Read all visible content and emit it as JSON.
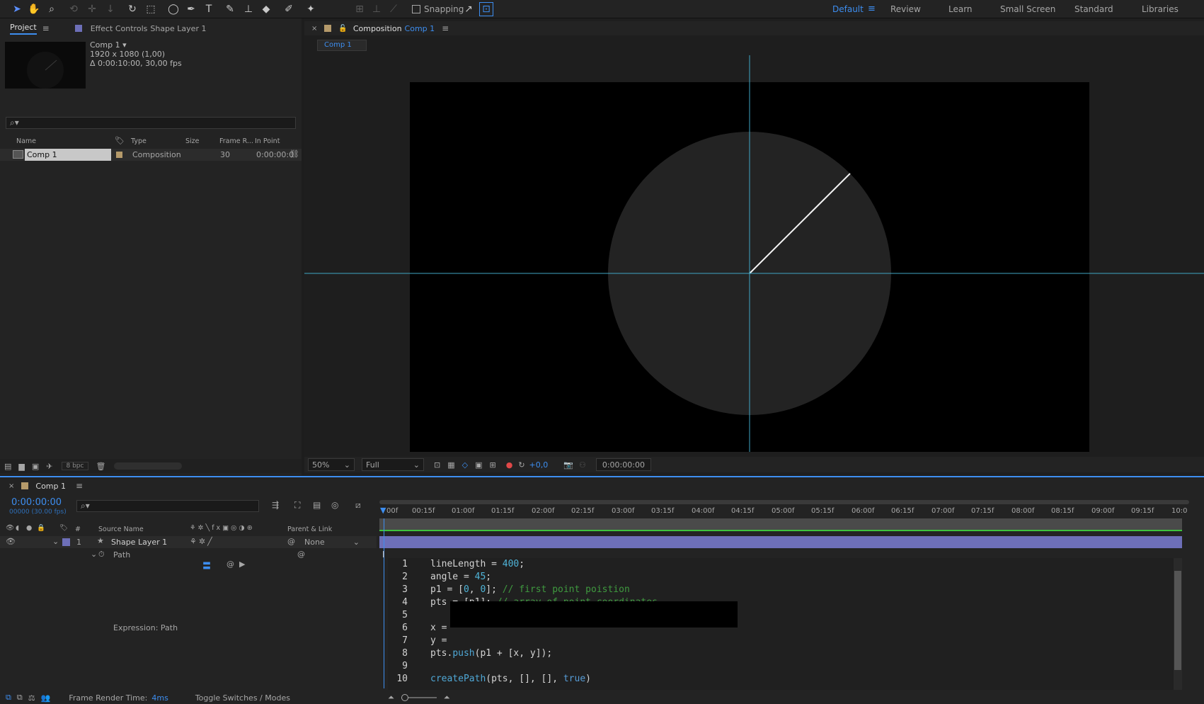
{
  "toolbar": {
    "snapping_label": "Snapping",
    "workspaces": [
      "Default",
      "Review",
      "Learn",
      "Small Screen",
      "Standard",
      "Libraries"
    ],
    "active_workspace": "Default"
  },
  "project_panel": {
    "tab_project": "Project",
    "tab_effect_controls": "Effect Controls",
    "effect_controls_target": "Shape Layer 1",
    "comp_name": "Comp 1 ▾",
    "comp_size": "1920 x 1080 (1,00)",
    "comp_duration": "Δ 0:00:10:00, 30,00 fps",
    "columns": [
      "Name",
      "Type",
      "Size",
      "Frame R...",
      "In Point"
    ],
    "items": [
      {
        "name": "Comp 1",
        "type": "Composition",
        "size": "",
        "frame_rate": "30",
        "in_point": "0:00:00:0"
      }
    ],
    "bpc": "8 bpc"
  },
  "viewer": {
    "tab_label": "Composition",
    "tab_comp": "Comp 1",
    "sub_tab": "Comp 1",
    "zoom": "50%",
    "resolution": "Full",
    "exposure": "+0,0",
    "timecode": "0:00:00:00"
  },
  "timeline": {
    "tab_label": "Comp 1",
    "current_time": "0:00:00:00",
    "frame_info": "00000 (30.00 fps)",
    "ruler_labels": [
      "00f",
      "00:15f",
      "01:00f",
      "01:15f",
      "02:00f",
      "02:15f",
      "03:00f",
      "03:15f",
      "04:00f",
      "04:15f",
      "05:00f",
      "05:15f",
      "06:00f",
      "06:15f",
      "07:00f",
      "07:15f",
      "08:00f",
      "08:15f",
      "09:00f",
      "09:15f",
      "10:0"
    ],
    "columns": {
      "hash": "#",
      "source_name": "Source Name",
      "parent_link": "Parent & Link"
    },
    "layers": [
      {
        "number": "1",
        "name": "Shape Layer 1",
        "parent": "None"
      }
    ],
    "property": "Path",
    "expression_label": "Expression: Path",
    "footer": {
      "render_time_label": "Frame Render Time:",
      "render_time_value": "4ms",
      "toggle_label": "Toggle Switches / Modes"
    },
    "code_lines": [
      {
        "n": "1",
        "html": "lineLength = <span class='num'>400</span>;"
      },
      {
        "n": "2",
        "html": "angle = <span class='num'>45</span>;"
      },
      {
        "n": "3",
        "html": "p1 = [<span class='num'>0</span>, <span class='num'>0</span>]; <span class='cm'>// first point poistion</span>"
      },
      {
        "n": "4",
        "html": "pts = [p1]; <span class='cm'>// array of point coordinates</span>"
      },
      {
        "n": "5",
        "html": ""
      },
      {
        "n": "6",
        "html": "x ="
      },
      {
        "n": "7",
        "html": "y ="
      },
      {
        "n": "8",
        "html": "pts.<span class='fn'>push</span>(p1 + [x, y]);"
      },
      {
        "n": "9",
        "html": ""
      },
      {
        "n": "10",
        "html": "<span class='fn'>createPath</span>(pts, [], [], <span class='kw'>true</span>)"
      }
    ]
  },
  "colors": {
    "accent": "#3d8ef0",
    "layer_bar": "#6d6fb8",
    "guide": "#3fa6c4"
  }
}
